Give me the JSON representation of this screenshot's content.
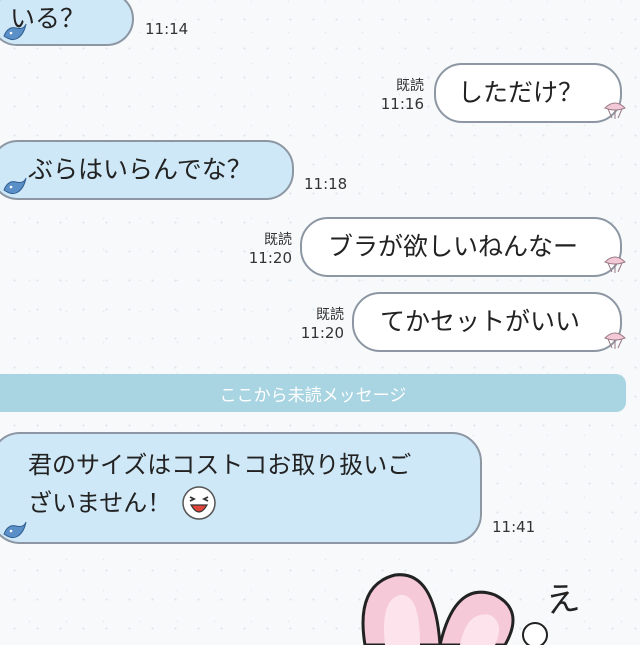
{
  "messages": [
    {
      "side": "left",
      "text": "いる？",
      "time": "11:14"
    },
    {
      "side": "right",
      "text": "しただけ？",
      "read": "既読",
      "time": "11:16"
    },
    {
      "side": "left",
      "text": "ぶらはいらんでな？",
      "time": "11:18"
    },
    {
      "side": "right",
      "text": "ブラが欲しいねんなー",
      "read": "既読",
      "time": "11:20"
    },
    {
      "side": "right",
      "text": "てかセットがいい",
      "read": "既読",
      "time": "11:20"
    },
    {
      "side": "left",
      "line1": "君のサイズはコストコお取り扱いご",
      "line2": "ざいません！",
      "time": "11:41"
    }
  ],
  "divider": {
    "label": "ここから未読メッセージ"
  },
  "sticker": {
    "handwriting": "え"
  },
  "icons": {
    "left_tail": "bird-icon",
    "right_tail": "sakura-icon",
    "emoji": "laughing-emoji-icon"
  },
  "colors": {
    "left_bubble": "#cfe8f7",
    "right_bubble": "#ffffff",
    "divider": "#a9d4e1",
    "border": "#8d97a3"
  }
}
